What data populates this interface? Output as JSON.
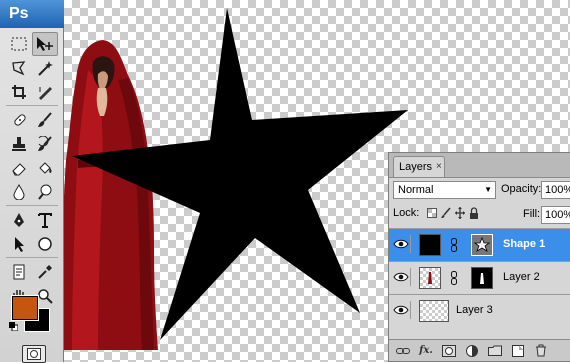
{
  "app": {
    "logo": "Ps"
  },
  "colors": {
    "foreground": "#c45612",
    "background": "#000000",
    "canvas_star": "#000000",
    "layer_selected": "#3b8fea"
  },
  "toolbox": {
    "tools": [
      "marquee-icon",
      "move-icon",
      "lasso-icon",
      "magic-wand-icon",
      "crop-icon",
      "slice-icon",
      "healing-brush-icon",
      "brush-icon",
      "clone-stamp-icon",
      "history-brush-icon",
      "eraser-icon",
      "paint-bucket-icon",
      "blur-icon",
      "dodge-icon",
      "pen-icon",
      "type-icon",
      "path-selection-icon",
      "ellipse-shape-icon",
      "notes-icon",
      "eyedropper-icon",
      "hand-icon",
      "zoom-icon"
    ]
  },
  "layers_panel": {
    "tab_label": "Layers",
    "tab_close": "×",
    "blend_mode": "Normal",
    "opacity_label": "Opacity:",
    "opacity_value": "100%",
    "lock_label": "Lock:",
    "fill_label": "Fill:",
    "fill_value": "100%",
    "layers": [
      {
        "name": "Shape 1",
        "visible": true,
        "selected": true
      },
      {
        "name": "Layer 2",
        "visible": true,
        "selected": false
      },
      {
        "name": "Layer 3",
        "visible": true,
        "selected": false
      }
    ],
    "footer_fx": "fx."
  }
}
